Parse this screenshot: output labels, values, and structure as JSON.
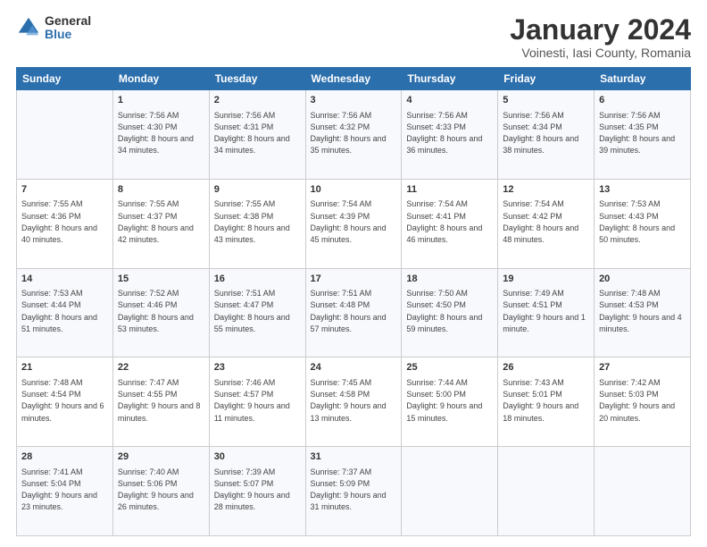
{
  "logo": {
    "general": "General",
    "blue": "Blue"
  },
  "title": "January 2024",
  "subtitle": "Voinesti, Iasi County, Romania",
  "days_header": [
    "Sunday",
    "Monday",
    "Tuesday",
    "Wednesday",
    "Thursday",
    "Friday",
    "Saturday"
  ],
  "weeks": [
    [
      {
        "num": "",
        "sunrise": "",
        "sunset": "",
        "daylight": ""
      },
      {
        "num": "1",
        "sunrise": "Sunrise: 7:56 AM",
        "sunset": "Sunset: 4:30 PM",
        "daylight": "Daylight: 8 hours and 34 minutes."
      },
      {
        "num": "2",
        "sunrise": "Sunrise: 7:56 AM",
        "sunset": "Sunset: 4:31 PM",
        "daylight": "Daylight: 8 hours and 34 minutes."
      },
      {
        "num": "3",
        "sunrise": "Sunrise: 7:56 AM",
        "sunset": "Sunset: 4:32 PM",
        "daylight": "Daylight: 8 hours and 35 minutes."
      },
      {
        "num": "4",
        "sunrise": "Sunrise: 7:56 AM",
        "sunset": "Sunset: 4:33 PM",
        "daylight": "Daylight: 8 hours and 36 minutes."
      },
      {
        "num": "5",
        "sunrise": "Sunrise: 7:56 AM",
        "sunset": "Sunset: 4:34 PM",
        "daylight": "Daylight: 8 hours and 38 minutes."
      },
      {
        "num": "6",
        "sunrise": "Sunrise: 7:56 AM",
        "sunset": "Sunset: 4:35 PM",
        "daylight": "Daylight: 8 hours and 39 minutes."
      }
    ],
    [
      {
        "num": "7",
        "sunrise": "Sunrise: 7:55 AM",
        "sunset": "Sunset: 4:36 PM",
        "daylight": "Daylight: 8 hours and 40 minutes."
      },
      {
        "num": "8",
        "sunrise": "Sunrise: 7:55 AM",
        "sunset": "Sunset: 4:37 PM",
        "daylight": "Daylight: 8 hours and 42 minutes."
      },
      {
        "num": "9",
        "sunrise": "Sunrise: 7:55 AM",
        "sunset": "Sunset: 4:38 PM",
        "daylight": "Daylight: 8 hours and 43 minutes."
      },
      {
        "num": "10",
        "sunrise": "Sunrise: 7:54 AM",
        "sunset": "Sunset: 4:39 PM",
        "daylight": "Daylight: 8 hours and 45 minutes."
      },
      {
        "num": "11",
        "sunrise": "Sunrise: 7:54 AM",
        "sunset": "Sunset: 4:41 PM",
        "daylight": "Daylight: 8 hours and 46 minutes."
      },
      {
        "num": "12",
        "sunrise": "Sunrise: 7:54 AM",
        "sunset": "Sunset: 4:42 PM",
        "daylight": "Daylight: 8 hours and 48 minutes."
      },
      {
        "num": "13",
        "sunrise": "Sunrise: 7:53 AM",
        "sunset": "Sunset: 4:43 PM",
        "daylight": "Daylight: 8 hours and 50 minutes."
      }
    ],
    [
      {
        "num": "14",
        "sunrise": "Sunrise: 7:53 AM",
        "sunset": "Sunset: 4:44 PM",
        "daylight": "Daylight: 8 hours and 51 minutes."
      },
      {
        "num": "15",
        "sunrise": "Sunrise: 7:52 AM",
        "sunset": "Sunset: 4:46 PM",
        "daylight": "Daylight: 8 hours and 53 minutes."
      },
      {
        "num": "16",
        "sunrise": "Sunrise: 7:51 AM",
        "sunset": "Sunset: 4:47 PM",
        "daylight": "Daylight: 8 hours and 55 minutes."
      },
      {
        "num": "17",
        "sunrise": "Sunrise: 7:51 AM",
        "sunset": "Sunset: 4:48 PM",
        "daylight": "Daylight: 8 hours and 57 minutes."
      },
      {
        "num": "18",
        "sunrise": "Sunrise: 7:50 AM",
        "sunset": "Sunset: 4:50 PM",
        "daylight": "Daylight: 8 hours and 59 minutes."
      },
      {
        "num": "19",
        "sunrise": "Sunrise: 7:49 AM",
        "sunset": "Sunset: 4:51 PM",
        "daylight": "Daylight: 9 hours and 1 minute."
      },
      {
        "num": "20",
        "sunrise": "Sunrise: 7:48 AM",
        "sunset": "Sunset: 4:53 PM",
        "daylight": "Daylight: 9 hours and 4 minutes."
      }
    ],
    [
      {
        "num": "21",
        "sunrise": "Sunrise: 7:48 AM",
        "sunset": "Sunset: 4:54 PM",
        "daylight": "Daylight: 9 hours and 6 minutes."
      },
      {
        "num": "22",
        "sunrise": "Sunrise: 7:47 AM",
        "sunset": "Sunset: 4:55 PM",
        "daylight": "Daylight: 9 hours and 8 minutes."
      },
      {
        "num": "23",
        "sunrise": "Sunrise: 7:46 AM",
        "sunset": "Sunset: 4:57 PM",
        "daylight": "Daylight: 9 hours and 11 minutes."
      },
      {
        "num": "24",
        "sunrise": "Sunrise: 7:45 AM",
        "sunset": "Sunset: 4:58 PM",
        "daylight": "Daylight: 9 hours and 13 minutes."
      },
      {
        "num": "25",
        "sunrise": "Sunrise: 7:44 AM",
        "sunset": "Sunset: 5:00 PM",
        "daylight": "Daylight: 9 hours and 15 minutes."
      },
      {
        "num": "26",
        "sunrise": "Sunrise: 7:43 AM",
        "sunset": "Sunset: 5:01 PM",
        "daylight": "Daylight: 9 hours and 18 minutes."
      },
      {
        "num": "27",
        "sunrise": "Sunrise: 7:42 AM",
        "sunset": "Sunset: 5:03 PM",
        "daylight": "Daylight: 9 hours and 20 minutes."
      }
    ],
    [
      {
        "num": "28",
        "sunrise": "Sunrise: 7:41 AM",
        "sunset": "Sunset: 5:04 PM",
        "daylight": "Daylight: 9 hours and 23 minutes."
      },
      {
        "num": "29",
        "sunrise": "Sunrise: 7:40 AM",
        "sunset": "Sunset: 5:06 PM",
        "daylight": "Daylight: 9 hours and 26 minutes."
      },
      {
        "num": "30",
        "sunrise": "Sunrise: 7:39 AM",
        "sunset": "Sunset: 5:07 PM",
        "daylight": "Daylight: 9 hours and 28 minutes."
      },
      {
        "num": "31",
        "sunrise": "Sunrise: 7:37 AM",
        "sunset": "Sunset: 5:09 PM",
        "daylight": "Daylight: 9 hours and 31 minutes."
      },
      {
        "num": "",
        "sunrise": "",
        "sunset": "",
        "daylight": ""
      },
      {
        "num": "",
        "sunrise": "",
        "sunset": "",
        "daylight": ""
      },
      {
        "num": "",
        "sunrise": "",
        "sunset": "",
        "daylight": ""
      }
    ]
  ]
}
